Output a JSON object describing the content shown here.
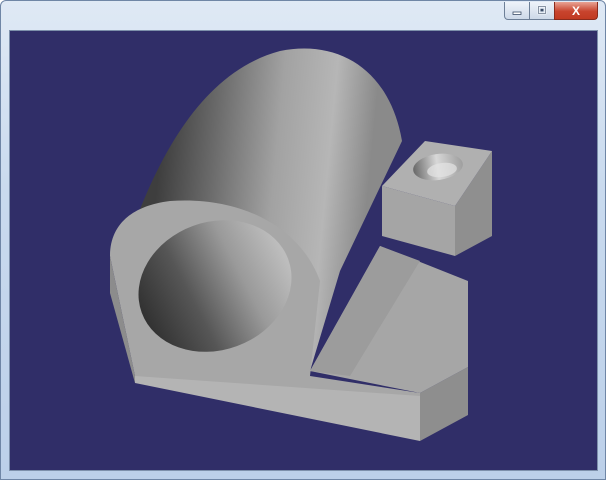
{
  "window": {
    "title": "",
    "controls": {
      "minimize_icon": "minimize-icon",
      "maximize_icon": "restore-icon",
      "close_label": "X"
    }
  },
  "viewport": {
    "background": "#302e68",
    "model_color": "#a9a9a9",
    "model": "bearing-block-3d"
  }
}
